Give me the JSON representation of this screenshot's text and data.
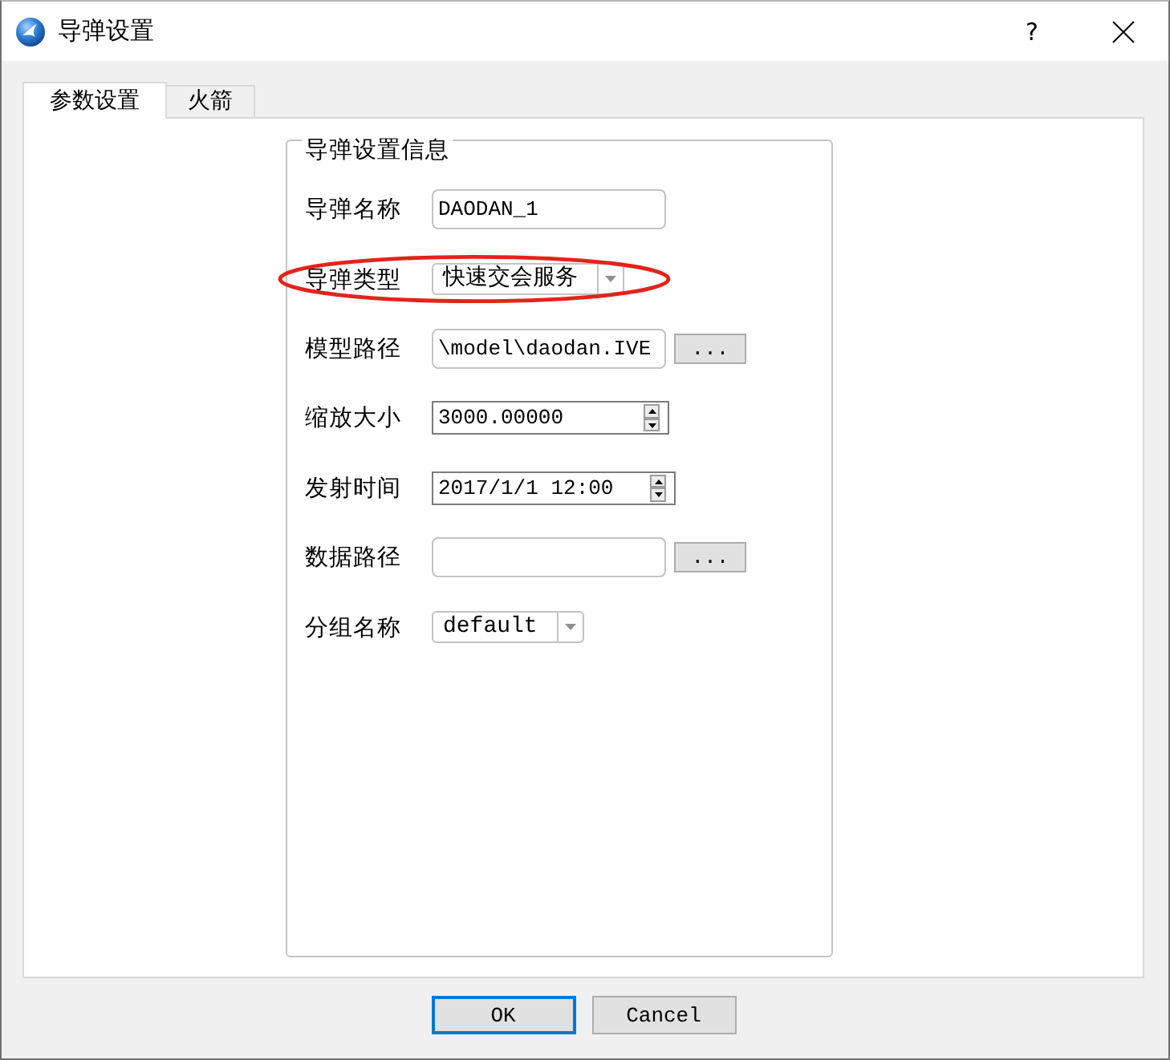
{
  "window": {
    "title": "导弹设置",
    "help": "?"
  },
  "tabs": [
    {
      "label": "参数设置",
      "selected": true
    },
    {
      "label": "火箭",
      "selected": false
    }
  ],
  "group": {
    "title": "导弹设置信息",
    "fields": [
      {
        "kind": "text",
        "label": "导弹名称",
        "value": "DAODAN_1",
        "highlighted": false
      },
      {
        "kind": "combo",
        "label": "导弹类型",
        "value": "快速交会服务",
        "highlighted": true
      },
      {
        "kind": "path",
        "label": "模型路径",
        "value": "\\model\\daodan.IVE",
        "button": "...",
        "highlighted": false
      },
      {
        "kind": "spin",
        "label": "缩放大小",
        "value": "3000.00000",
        "highlighted": false
      },
      {
        "kind": "spin",
        "label": "发射时间",
        "value": "2017/1/1 12:00",
        "highlighted": false
      },
      {
        "kind": "path",
        "label": "数据路径",
        "button": "...",
        "highlighted": false
      },
      {
        "kind": "combo",
        "label": "分组名称",
        "value": "default",
        "highlighted": false
      }
    ]
  },
  "buttons": [
    {
      "label": "OK",
      "default": true
    },
    {
      "label": "Cancel",
      "default": false
    }
  ]
}
